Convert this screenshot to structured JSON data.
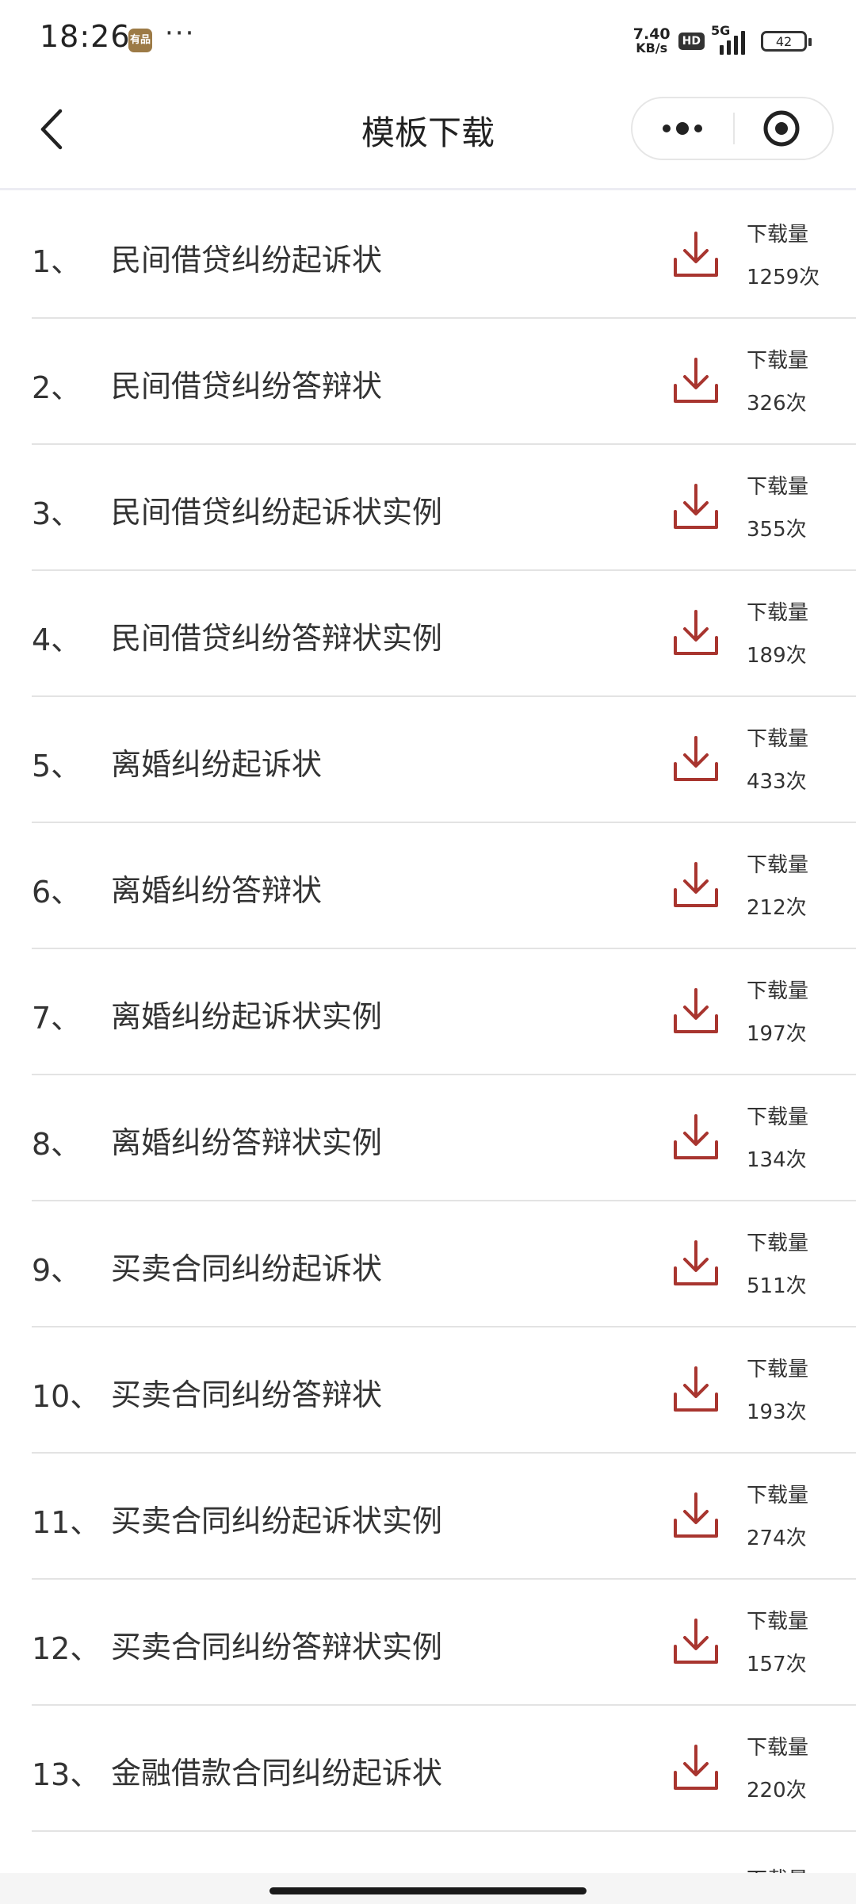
{
  "status_bar": {
    "time": "18:26",
    "app_badge": "有品",
    "dots": "···",
    "net_speed": "7.40",
    "net_unit": "KB/s",
    "hd": "HD",
    "network": "5G",
    "battery": "42"
  },
  "nav": {
    "title": "模板下载"
  },
  "list": {
    "count_label": "下载量",
    "items": [
      {
        "index": "1、",
        "title": "民间借贷纠纷起诉状",
        "count": "1259次"
      },
      {
        "index": "2、",
        "title": "民间借贷纠纷答辩状",
        "count": "326次"
      },
      {
        "index": "3、",
        "title": "民间借贷纠纷起诉状实例",
        "count": "355次"
      },
      {
        "index": "4、",
        "title": "民间借贷纠纷答辩状实例",
        "count": "189次"
      },
      {
        "index": "5、",
        "title": "离婚纠纷起诉状",
        "count": "433次"
      },
      {
        "index": "6、",
        "title": "离婚纠纷答辩状",
        "count": "212次"
      },
      {
        "index": "7、",
        "title": "离婚纠纷起诉状实例",
        "count": "197次"
      },
      {
        "index": "8、",
        "title": "离婚纠纷答辩状实例",
        "count": "134次"
      },
      {
        "index": "9、",
        "title": "买卖合同纠纷起诉状",
        "count": "511次"
      },
      {
        "index": "10、",
        "title": "买卖合同纠纷答辩状",
        "count": "193次"
      },
      {
        "index": "11、",
        "title": "买卖合同纠纷起诉状实例",
        "count": "274次"
      },
      {
        "index": "12、",
        "title": "买卖合同纠纷答辩状实例",
        "count": "157次"
      },
      {
        "index": "13、",
        "title": "金融借款合同纠纷起诉状",
        "count": "220次"
      }
    ]
  },
  "colors": {
    "download_icon": "#a8352f",
    "divider": "#e3e3e3",
    "text": "#333333"
  }
}
